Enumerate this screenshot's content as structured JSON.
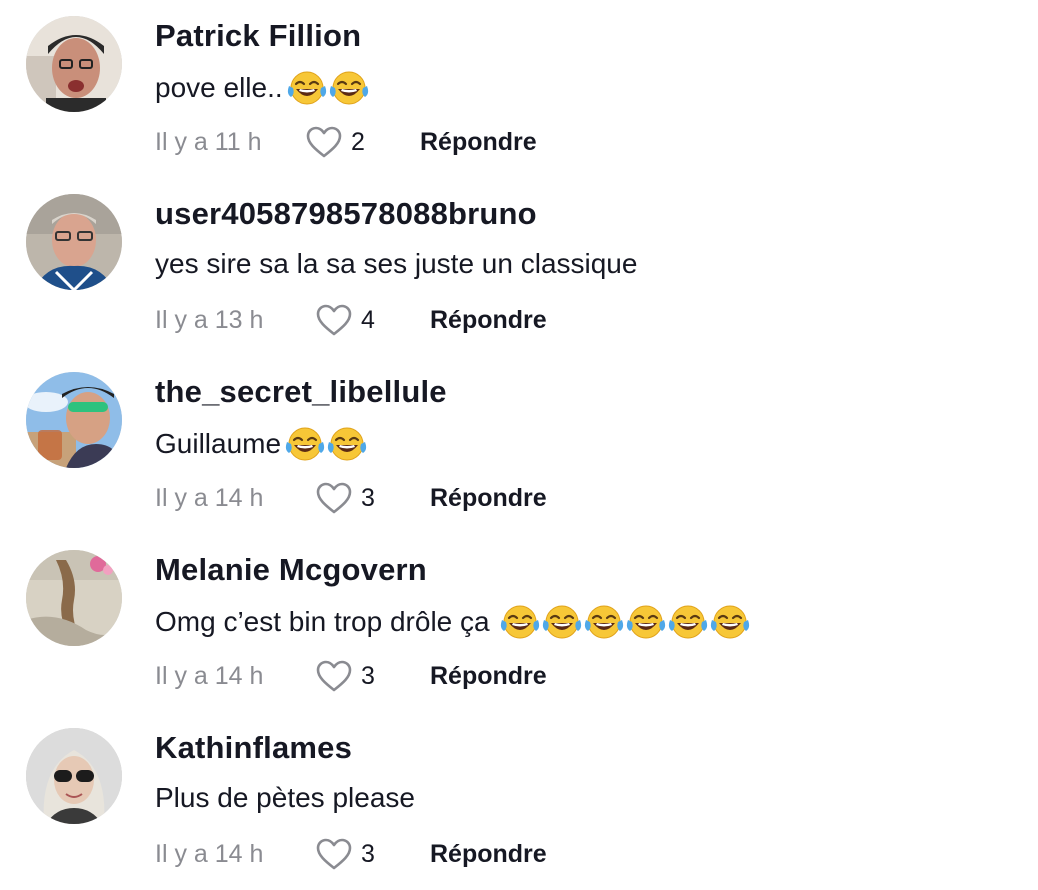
{
  "comments": [
    {
      "username": "Patrick Fillion",
      "text": "pove elle..",
      "emoji_count": 2,
      "time": "Il y a 11 h",
      "likes": "2",
      "reply_label": "Répondre",
      "avatar_colors": [
        "#2b2b2b",
        "#c98f7a",
        "#6b4a3a"
      ]
    },
    {
      "username": "user4058798578088bruno",
      "text": "yes sire sa la sa ses juste un classique",
      "emoji_count": 0,
      "time": "Il y a 13 h",
      "likes": "4",
      "reply_label": "Répondre",
      "avatar_colors": [
        "#a9a39a",
        "#d9a48f",
        "#1f4f8a"
      ]
    },
    {
      "username": "the_secret_libellule",
      "text": "Guillaume",
      "emoji_count": 2,
      "time": "Il y a 14 h",
      "likes": "3",
      "reply_label": "Répondre",
      "avatar_colors": [
        "#8fbde8",
        "#d6a184",
        "#3b3b55"
      ]
    },
    {
      "username": "Melanie Mcgovern",
      "text": "Omg c’est bin trop drôle ça",
      "emoji_count": 6,
      "time": "Il y a 14 h",
      "likes": "3",
      "reply_label": "Répondre",
      "avatar_colors": [
        "#d8d2c4",
        "#8a6a4a",
        "#b07a5a"
      ]
    },
    {
      "username": "Kathinflames",
      "text": "Plus de pètes please",
      "emoji_count": 0,
      "time": "Il y a 14 h",
      "likes": "3",
      "reply_label": "Répondre",
      "avatar_colors": [
        "#d9d9d9",
        "#e6c9b5",
        "#1c1c1c"
      ]
    }
  ],
  "icons": {
    "like": "heart-outline-icon",
    "emoji": "face-with-tears-of-joy-icon"
  },
  "colors": {
    "text": "#161823",
    "muted": "#8a8b91",
    "background": "#ffffff"
  }
}
